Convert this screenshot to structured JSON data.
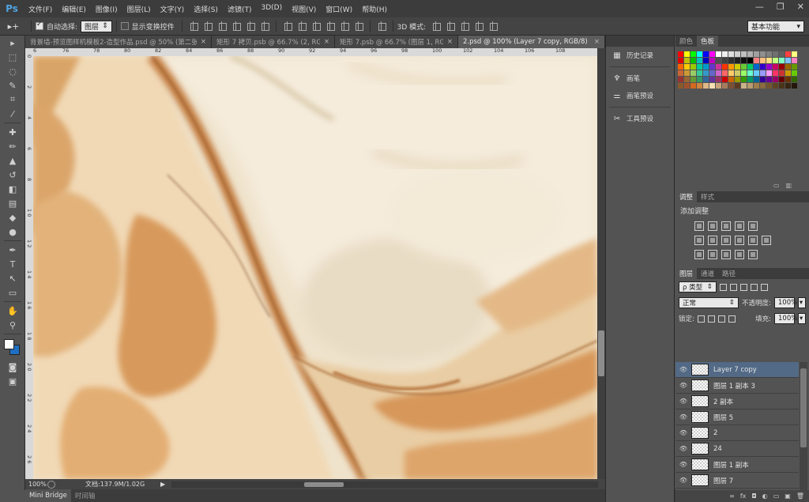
{
  "app": {
    "logo": "Ps"
  },
  "menu": [
    "文件(F)",
    "编辑(E)",
    "图像(I)",
    "图层(L)",
    "文字(Y)",
    "选择(S)",
    "滤镜(T)",
    "3D(D)",
    "视图(V)",
    "窗口(W)",
    "帮助(H)"
  ],
  "window_controls": {
    "minimize": "—",
    "restore": "❐",
    "close": "✕"
  },
  "options": {
    "move_tool": "▸+",
    "auto_select_label": "自动选择:",
    "auto_select_checked": true,
    "auto_select_target": "图层",
    "show_transform_label": "显示变换控件",
    "show_transform_checked": false,
    "mode_3d_label": "3D 模式:",
    "workspace": "基本功能"
  },
  "doc_tabs": [
    {
      "label": "背景墙-预览图样机模板2-造型作品.psd @ 50% (第二张...",
      "active": false
    },
    {
      "label": "矩形 7 拷贝.psb @ 66.7% (2, RGB/...",
      "active": false
    },
    {
      "label": "矩形 7.psb @ 66.7% (图层 1, RGB/...",
      "active": false
    },
    {
      "label": "2.psd @ 100% (Layer 7 copy, RGB/8)",
      "active": true
    }
  ],
  "ruler_top": [
    "6",
    "76",
    "78",
    "80",
    "82",
    "84",
    "86",
    "88",
    "90",
    "92",
    "94",
    "96",
    "98",
    "100",
    "102",
    "104",
    "106",
    "108"
  ],
  "ruler_left": [
    "0",
    "2",
    "4",
    "6",
    "8",
    "1 0",
    "1 2",
    "1 4",
    "1 6",
    "1 8",
    "2 0",
    "2 2",
    "2 4",
    "2 6"
  ],
  "status": {
    "zoom": "100%",
    "doc_info": "文档:137.9M/1.02G",
    "arrow": "▶"
  },
  "bottom_tabs": [
    "Mini Bridge",
    "时间轴"
  ],
  "dock": [
    {
      "icon": "history-icon",
      "glyph": "▦",
      "label": "历史记录"
    },
    {
      "icon": "brush-icon",
      "glyph": "♆",
      "label": "画笔"
    },
    {
      "icon": "brush-preset-icon",
      "glyph": "⚌",
      "label": "画笔预设"
    },
    {
      "icon": "tool-preset-icon",
      "glyph": "✂",
      "label": "工具预设"
    }
  ],
  "color_panel": {
    "tabs": [
      "颜色",
      "色板"
    ],
    "active_tab": 1,
    "swatches": [
      "#ff0000",
      "#ffff00",
      "#00ff00",
      "#00ffff",
      "#0000ff",
      "#ff00ff",
      "#ffffff",
      "#f0f0f0",
      "#e0e0e0",
      "#d0d0d0",
      "#c0c0c0",
      "#b0b0b0",
      "#a0a0a0",
      "#909090",
      "#808080",
      "#707070",
      "#606060",
      "#ff4040",
      "#ffff80",
      "#e00000",
      "#c0c000",
      "#00c000",
      "#00c0c0",
      "#0000c0",
      "#c000c0",
      "#505050",
      "#404040",
      "#303030",
      "#202020",
      "#101010",
      "#000000",
      "#ff8080",
      "#ffc080",
      "#ffe080",
      "#c0ff80",
      "#80ffc0",
      "#80c0ff",
      "#ff80c0",
      "#ff6600",
      "#ffcc00",
      "#99cc00",
      "#00cc99",
      "#0099cc",
      "#6633cc",
      "#cc3399",
      "#ff3300",
      "#ff9900",
      "#cccc00",
      "#66cc33",
      "#00cc66",
      "#0066cc",
      "#3300cc",
      "#9900cc",
      "#cc0066",
      "#990000",
      "#996600",
      "#669900",
      "#cc6633",
      "#cc9933",
      "#99cc66",
      "#33cc99",
      "#3399cc",
      "#6666cc",
      "#cc66cc",
      "#ff6666",
      "#ffcc66",
      "#cccc66",
      "#99ff66",
      "#66ffcc",
      "#66ccff",
      "#9999ff",
      "#ff99ff",
      "#ff3366",
      "#cc3333",
      "#cc9900",
      "#66cc00",
      "#993333",
      "#996633",
      "#669933",
      "#339966",
      "#336699",
      "#663399",
      "#993366",
      "#cc0000",
      "#cc6600",
      "#999900",
      "#339900",
      "#009966",
      "#006699",
      "#330099",
      "#660099",
      "#990066",
      "#660000",
      "#663300",
      "#336600",
      "#8b5a2b",
      "#a0522d",
      "#d2691e",
      "#cd853f",
      "#deb887",
      "#f5deb3",
      "#c8a27a",
      "#a67b5b",
      "#7b5035",
      "#5c3a21",
      "#c9b18a",
      "#b89b6e",
      "#a07d4e",
      "#8a6a3e",
      "#735530",
      "#5e4424",
      "#4a341a",
      "#362512",
      "#22170a"
    ]
  },
  "adjust_panel": {
    "tabs": [
      "调整",
      "样式"
    ],
    "active_tab": 0,
    "title": "添加调整"
  },
  "layers_panel": {
    "tabs": [
      "图层",
      "通道",
      "路径"
    ],
    "active_tab": 0,
    "filter": "ρ 类型",
    "blend_mode": "正常",
    "opacity_label": "不透明度:",
    "opacity": "100%",
    "lock_label": "锁定:",
    "fill_label": "填充:",
    "fill": "100%",
    "layers": [
      {
        "name": "Layer 7 copy",
        "active": true
      },
      {
        "name": "图层 1 副本 3",
        "active": false
      },
      {
        "name": "2 副本",
        "active": false
      },
      {
        "name": "图层 5",
        "active": false
      },
      {
        "name": "2",
        "active": false
      },
      {
        "name": "24",
        "active": false
      },
      {
        "name": "图层 1 副本",
        "active": false
      },
      {
        "name": "图层 7",
        "active": false
      }
    ],
    "footer_icons": [
      "∞",
      "fx",
      "◘",
      "◐",
      "▭",
      "▣",
      "🗑"
    ]
  },
  "tools": [
    {
      "name": "move-tool-icon",
      "glyph": "▸"
    },
    {
      "name": "marquee-tool-icon",
      "glyph": "⬚"
    },
    {
      "name": "lasso-tool-icon",
      "glyph": "◌"
    },
    {
      "name": "quick-select-tool-icon",
      "glyph": "✎"
    },
    {
      "name": "crop-tool-icon",
      "glyph": "⌗"
    },
    {
      "name": "eyedropper-tool-icon",
      "glyph": "⁄"
    },
    {
      "name": "healing-tool-icon",
      "glyph": "✚"
    },
    {
      "name": "brush-tool-icon",
      "glyph": "✏"
    },
    {
      "name": "stamp-tool-icon",
      "glyph": "▲"
    },
    {
      "name": "history-brush-tool-icon",
      "glyph": "↺"
    },
    {
      "name": "eraser-tool-icon",
      "glyph": "◧"
    },
    {
      "name": "gradient-tool-icon",
      "glyph": "▤"
    },
    {
      "name": "blur-tool-icon",
      "glyph": "◆"
    },
    {
      "name": "dodge-tool-icon",
      "glyph": "●"
    },
    {
      "name": "pen-tool-icon",
      "glyph": "✒"
    },
    {
      "name": "type-tool-icon",
      "glyph": "T"
    },
    {
      "name": "path-select-tool-icon",
      "glyph": "↖"
    },
    {
      "name": "shape-tool-icon",
      "glyph": "▭"
    },
    {
      "name": "hand-tool-icon",
      "glyph": "✋"
    },
    {
      "name": "zoom-tool-icon",
      "glyph": "⚲"
    }
  ],
  "colors": {
    "foreground": "#ffffff",
    "background": "#1f6fc1",
    "active_layer": "#526a86"
  }
}
